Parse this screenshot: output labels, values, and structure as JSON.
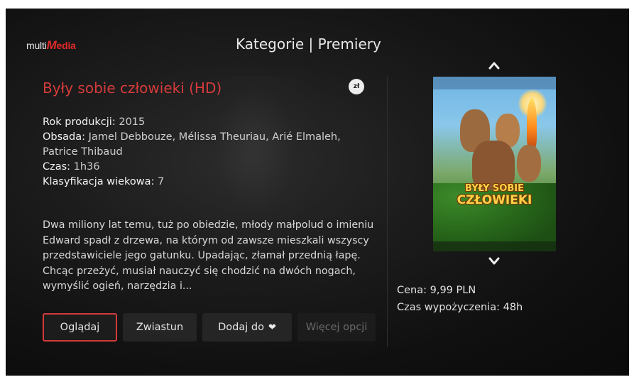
{
  "header": {
    "logo": {
      "prefix": "multi",
      "m": "M",
      "rest": "edia"
    },
    "title": "Kategorie | Premiery"
  },
  "movie": {
    "title": "Były sobie człowieki (HD)",
    "badge": "zł",
    "year_label": "Rok produkcji:",
    "year_value": "2015",
    "cast_label": "Obsada:",
    "cast_value": "Jamel Debbouze, Mélissa Theuriau, Arié Elmaleh, Patrice Thibaud",
    "duration_label": "Czas:",
    "duration_value": "1h36",
    "age_label": "Klasyfikacja wiekowa:",
    "age_value": "7",
    "description": "Dwa miliony lat temu, tuż po obiedzie, młody małpolud o imieniu Edward spadł z drzewa, na którym od zawsze mieszkali wszyscy przedstawiciele jego gatunku. Upadając, złamał przednią łapę. Chcąc przeżyć, musiał nauczyć się chodzić na dwóch nogach, wymyślić ogień, narzędzia i..."
  },
  "buttons": {
    "watch": "Oglądaj",
    "trailer": "Zwiastun",
    "add": "Dodaj do",
    "more": "Więcej opcji"
  },
  "poster": {
    "title_line1": "BYŁY SOBIE",
    "title_line2": "CZŁOWIEKI"
  },
  "side": {
    "price": "Cena: 9,99 PLN",
    "rental": "Czas wypożyczenia: 48h"
  },
  "icons": {
    "up": "chevron-up-icon",
    "down": "chevron-down-icon",
    "heart": "heart-icon"
  },
  "colors": {
    "accent": "#d63b3b",
    "background": "#141414"
  }
}
